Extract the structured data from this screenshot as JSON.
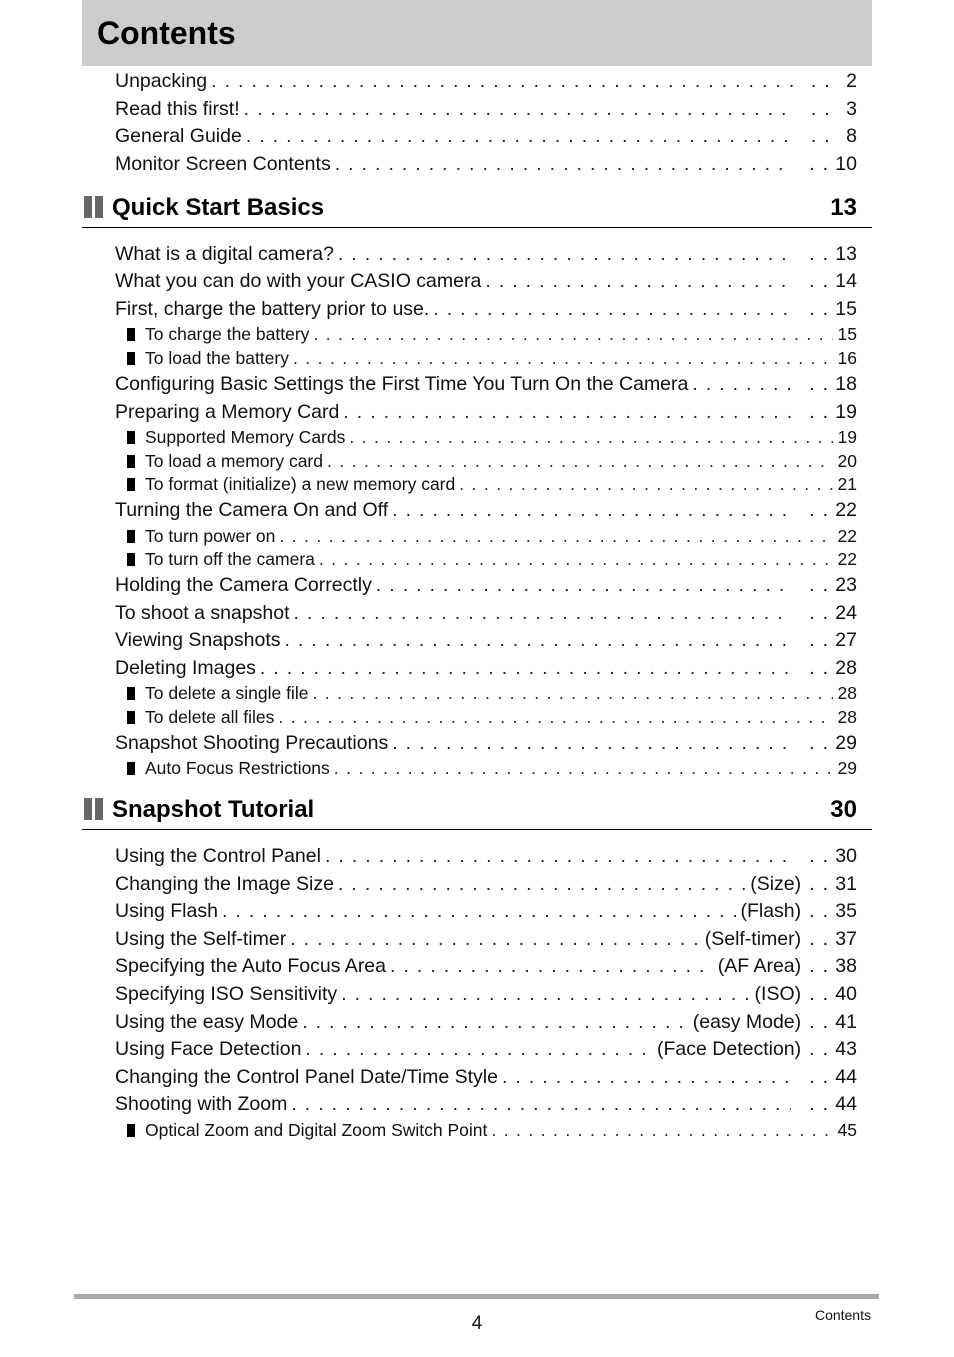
{
  "title": "Contents",
  "intro_entries": [
    {
      "label": "Unpacking",
      "page": "2"
    },
    {
      "label": "Read this first!",
      "page": "3"
    },
    {
      "label": "General Guide",
      "page": "8"
    },
    {
      "label": "Monitor Screen Contents",
      "page": "10"
    }
  ],
  "sections": [
    {
      "title": "Quick Start Basics",
      "page": "13",
      "icon": "section-bars-icon",
      "entries": [
        {
          "label": "What is a digital camera?",
          "page": "13",
          "level": 1
        },
        {
          "label": "What you can do with your CASIO camera",
          "page": "14",
          "level": 1
        },
        {
          "label": "First, charge the battery prior to use.",
          "page": "15",
          "level": 1
        },
        {
          "label": "To charge the battery",
          "page": "15",
          "level": 2
        },
        {
          "label": "To load the battery",
          "page": "16",
          "level": 2
        },
        {
          "label": "Configuring Basic Settings the First Time You Turn On the Camera",
          "page": "18",
          "level": 1
        },
        {
          "label": "Preparing a Memory Card",
          "page": "19",
          "level": 1
        },
        {
          "label": "Supported Memory Cards",
          "page": "19",
          "level": 2
        },
        {
          "label": "To load a memory card",
          "page": "20",
          "level": 2
        },
        {
          "label": "To format (initialize) a new memory card",
          "page": "21",
          "level": 2
        },
        {
          "label": "Turning the Camera On and Off",
          "page": "22",
          "level": 1
        },
        {
          "label": "To turn power on",
          "page": "22",
          "level": 2
        },
        {
          "label": "To turn off the camera",
          "page": "22",
          "level": 2
        },
        {
          "label": "Holding the Camera Correctly",
          "page": "23",
          "level": 1
        },
        {
          "label": "To shoot a snapshot",
          "page": "24",
          "level": 1
        },
        {
          "label": "Viewing Snapshots",
          "page": "27",
          "level": 1
        },
        {
          "label": "Deleting Images",
          "page": "28",
          "level": 1
        },
        {
          "label": "To delete a single file",
          "page": "28",
          "level": 2
        },
        {
          "label": "To delete all files",
          "page": "28",
          "level": 2
        },
        {
          "label": "Snapshot Shooting Precautions",
          "page": "29",
          "level": 1
        },
        {
          "label": "Auto Focus Restrictions",
          "page": "29",
          "level": 2
        }
      ]
    },
    {
      "title": "Snapshot Tutorial",
      "page": "30",
      "icon": "section-bars-icon",
      "entries": [
        {
          "label": "Using the Control Panel",
          "page": "30",
          "level": 1
        },
        {
          "label": "Changing the Image Size",
          "suffix": "(Size)",
          "page": "31",
          "level": 1
        },
        {
          "label": "Using Flash",
          "suffix": "(Flash)",
          "page": "35",
          "level": 1
        },
        {
          "label": "Using the Self-timer",
          "suffix": "(Self-timer)",
          "page": "37",
          "level": 1
        },
        {
          "label": "Specifying the Auto Focus Area",
          "suffix": "(AF Area)",
          "page": "38",
          "level": 1
        },
        {
          "label": "Specifying ISO Sensitivity",
          "suffix": "(ISO)",
          "page": "40",
          "level": 1
        },
        {
          "label": "Using the easy Mode",
          "suffix": "(easy Mode)",
          "page": "41",
          "level": 1
        },
        {
          "label": "Using Face Detection",
          "suffix": "(Face Detection)",
          "page": "43",
          "level": 1
        },
        {
          "label": "Changing the Control Panel Date/Time Style",
          "page": "44",
          "level": 1
        },
        {
          "label": "Shooting with Zoom",
          "page": "44",
          "level": 1
        },
        {
          "label": "Optical Zoom and Digital Zoom Switch Point",
          "page": "45",
          "level": 2
        }
      ]
    }
  ],
  "footer": {
    "page_number": "4",
    "section_label": "Contents"
  },
  "colors": {
    "title_bar": "#cccccc",
    "section_icon": "#666666",
    "footer_rule": "#aaaaaa"
  }
}
